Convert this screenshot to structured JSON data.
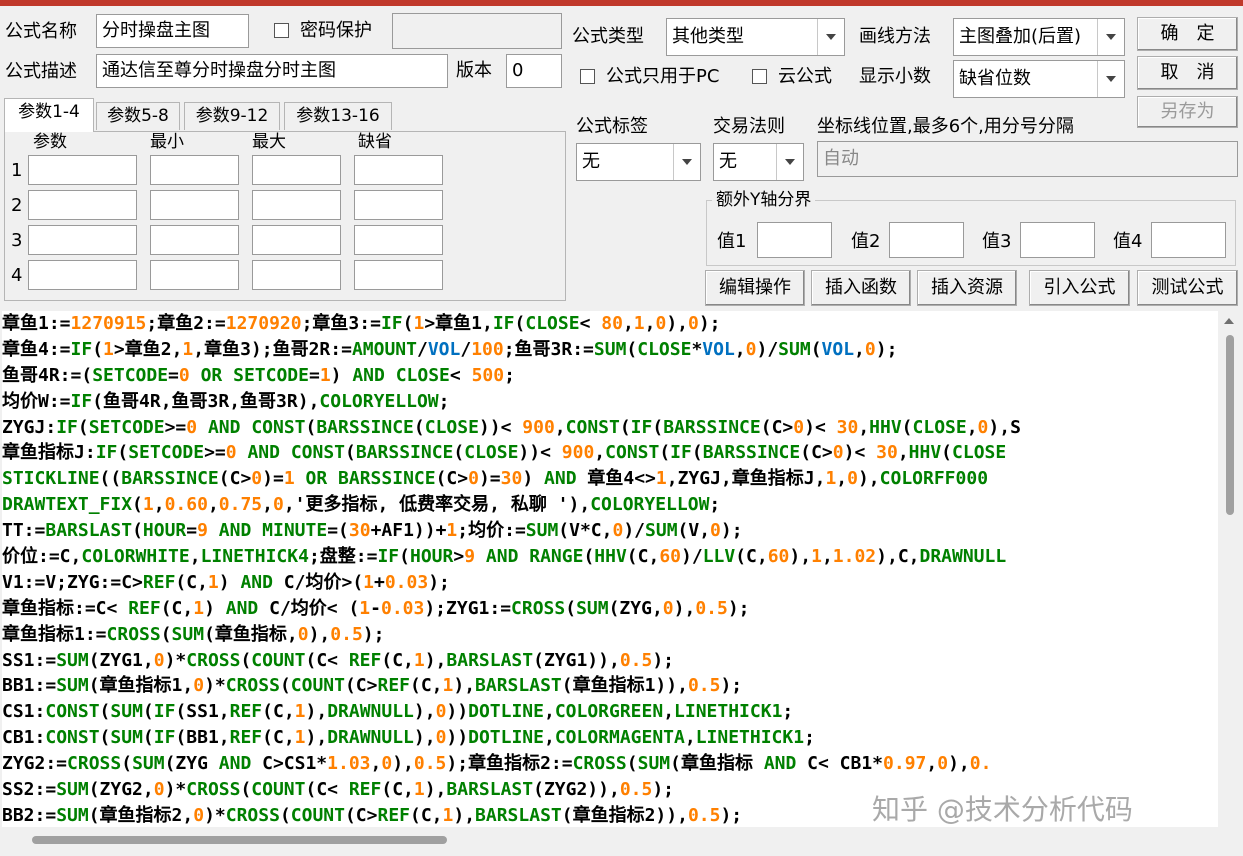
{
  "form": {
    "name_label": "公式名称",
    "name_value": "分时操盘主图",
    "password_label": "密码保护",
    "password_checked": false,
    "desc_label": "公式描述",
    "desc_value": "通达信至尊分时操盘分时主图",
    "version_label": "版本",
    "version_value": "0",
    "type_label": "公式类型",
    "type_value": "其他类型",
    "draw_label": "画线方法",
    "draw_value": "主图叠加(后置)",
    "pc_only_label": "公式只用于PC",
    "pc_only_checked": false,
    "cloud_label": "云公式",
    "cloud_checked": false,
    "decimals_label": "显示小数",
    "decimals_value": "缺省位数",
    "tag_label": "公式标签",
    "tag_value": "无",
    "trade_label": "交易法则",
    "trade_value": "无",
    "axis_label": "坐标线位置,最多6个,用分号分隔",
    "axis_placeholder": "自动",
    "extra_y_title": "额外Y轴分界",
    "extra_y": [
      "值1",
      "值2",
      "值3",
      "值4"
    ]
  },
  "buttons": {
    "ok": "确　定",
    "cancel": "取　消",
    "save_as": "另存为",
    "edit_ops": "编辑操作",
    "insert_func": "插入函数",
    "insert_res": "插入资源",
    "import_formula": "引入公式",
    "test_formula": "测试公式"
  },
  "param_tabs": [
    "参数1-4",
    "参数5-8",
    "参数9-12",
    "参数13-16"
  ],
  "param_headers": [
    "参数",
    "最小",
    "最大",
    "缺省"
  ],
  "param_rows": [
    "1",
    "2",
    "3",
    "4"
  ],
  "colors": {
    "keyword": "#008000",
    "number": "#ff8000",
    "system": "#0070c0",
    "text": "#000000"
  },
  "code_lines": [
    [
      [
        "章鱼1:=",
        "t"
      ],
      [
        "1270915",
        "n"
      ],
      [
        ";章鱼2:=",
        "t"
      ],
      [
        "1270920",
        "n"
      ],
      [
        ";章鱼3:=",
        "t"
      ],
      [
        "IF",
        "k"
      ],
      [
        "(",
        "t"
      ],
      [
        "1",
        "n"
      ],
      [
        ">章鱼1,",
        "t"
      ],
      [
        "IF",
        "k"
      ],
      [
        "(",
        "t"
      ],
      [
        "CLOSE",
        "k"
      ],
      [
        "< ",
        "t"
      ],
      [
        "80",
        "n"
      ],
      [
        ",",
        "t"
      ],
      [
        "1",
        "n"
      ],
      [
        ",",
        "t"
      ],
      [
        "0",
        "n"
      ],
      [
        "),",
        "t"
      ],
      [
        "0",
        "n"
      ],
      [
        ");",
        "t"
      ]
    ],
    [
      [
        "章鱼4:=",
        "t"
      ],
      [
        "IF",
        "k"
      ],
      [
        "(",
        "t"
      ],
      [
        "1",
        "n"
      ],
      [
        ">章鱼2,",
        "t"
      ],
      [
        "1",
        "n"
      ],
      [
        ",章鱼3);鱼哥2R:=",
        "t"
      ],
      [
        "AMOUNT",
        "k"
      ],
      [
        "/",
        "t"
      ],
      [
        "VOL",
        "s"
      ],
      [
        "/",
        "t"
      ],
      [
        "100",
        "n"
      ],
      [
        ";鱼哥3R:=",
        "t"
      ],
      [
        "SUM",
        "k"
      ],
      [
        "(",
        "t"
      ],
      [
        "CLOSE",
        "k"
      ],
      [
        "*",
        "t"
      ],
      [
        "VOL",
        "s"
      ],
      [
        ",",
        "t"
      ],
      [
        "0",
        "n"
      ],
      [
        ")/",
        "t"
      ],
      [
        "SUM",
        "k"
      ],
      [
        "(",
        "t"
      ],
      [
        "VOL",
        "s"
      ],
      [
        ",",
        "t"
      ],
      [
        "0",
        "n"
      ],
      [
        ");",
        "t"
      ]
    ],
    [
      [
        "鱼哥4R:=(",
        "t"
      ],
      [
        "SETCODE",
        "k"
      ],
      [
        "=",
        "t"
      ],
      [
        "0",
        "n"
      ],
      [
        " ",
        "t"
      ],
      [
        "OR",
        "k"
      ],
      [
        " ",
        "t"
      ],
      [
        "SETCODE",
        "k"
      ],
      [
        "=",
        "t"
      ],
      [
        "1",
        "n"
      ],
      [
        ") ",
        "t"
      ],
      [
        "AND",
        "k"
      ],
      [
        " ",
        "t"
      ],
      [
        "CLOSE",
        "k"
      ],
      [
        "< ",
        "t"
      ],
      [
        "500",
        "n"
      ],
      [
        ";",
        "t"
      ]
    ],
    [
      [
        "均价W:=",
        "t"
      ],
      [
        "IF",
        "k"
      ],
      [
        "(鱼哥4R,鱼哥3R,鱼哥3R),",
        "t"
      ],
      [
        "COLORYELLOW",
        "k"
      ],
      [
        ";",
        "t"
      ]
    ],
    [
      [
        "ZYGJ:",
        "t"
      ],
      [
        "IF",
        "k"
      ],
      [
        "(",
        "t"
      ],
      [
        "SETCODE",
        "k"
      ],
      [
        ">=",
        "t"
      ],
      [
        "0",
        "n"
      ],
      [
        " ",
        "t"
      ],
      [
        "AND",
        "k"
      ],
      [
        " ",
        "t"
      ],
      [
        "CONST",
        "k"
      ],
      [
        "(",
        "t"
      ],
      [
        "BARSSINCE",
        "k"
      ],
      [
        "(",
        "t"
      ],
      [
        "CLOSE",
        "k"
      ],
      [
        "))< ",
        "t"
      ],
      [
        "900",
        "n"
      ],
      [
        ",",
        "t"
      ],
      [
        "CONST",
        "k"
      ],
      [
        "(",
        "t"
      ],
      [
        "IF",
        "k"
      ],
      [
        "(",
        "t"
      ],
      [
        "BARSSINCE",
        "k"
      ],
      [
        "(C>",
        "t"
      ],
      [
        "0",
        "n"
      ],
      [
        ")< ",
        "t"
      ],
      [
        "30",
        "n"
      ],
      [
        ",",
        "t"
      ],
      [
        "HHV",
        "k"
      ],
      [
        "(",
        "t"
      ],
      [
        "CLOSE",
        "k"
      ],
      [
        ",",
        "t"
      ],
      [
        "0",
        "n"
      ],
      [
        "),S",
        "t"
      ]
    ],
    [
      [
        "章鱼指标J:",
        "t"
      ],
      [
        "IF",
        "k"
      ],
      [
        "(",
        "t"
      ],
      [
        "SETCODE",
        "k"
      ],
      [
        ">=",
        "t"
      ],
      [
        "0",
        "n"
      ],
      [
        " ",
        "t"
      ],
      [
        "AND",
        "k"
      ],
      [
        " ",
        "t"
      ],
      [
        "CONST",
        "k"
      ],
      [
        "(",
        "t"
      ],
      [
        "BARSSINCE",
        "k"
      ],
      [
        "(",
        "t"
      ],
      [
        "CLOSE",
        "k"
      ],
      [
        "))< ",
        "t"
      ],
      [
        "900",
        "n"
      ],
      [
        ",",
        "t"
      ],
      [
        "CONST",
        "k"
      ],
      [
        "(",
        "t"
      ],
      [
        "IF",
        "k"
      ],
      [
        "(",
        "t"
      ],
      [
        "BARSSINCE",
        "k"
      ],
      [
        "(C>",
        "t"
      ],
      [
        "0",
        "n"
      ],
      [
        ")< ",
        "t"
      ],
      [
        "30",
        "n"
      ],
      [
        ",",
        "t"
      ],
      [
        "HHV",
        "k"
      ],
      [
        "(",
        "t"
      ],
      [
        "CLOSE",
        "k"
      ]
    ],
    [
      [
        "STICKLINE",
        "k"
      ],
      [
        "((",
        "t"
      ],
      [
        "BARSSINCE",
        "k"
      ],
      [
        "(C>",
        "t"
      ],
      [
        "0",
        "n"
      ],
      [
        ")=",
        "t"
      ],
      [
        "1",
        "n"
      ],
      [
        " ",
        "t"
      ],
      [
        "OR",
        "k"
      ],
      [
        " ",
        "t"
      ],
      [
        "BARSSINCE",
        "k"
      ],
      [
        "(C>",
        "t"
      ],
      [
        "0",
        "n"
      ],
      [
        ")=",
        "t"
      ],
      [
        "30",
        "n"
      ],
      [
        ") ",
        "t"
      ],
      [
        "AND",
        "k"
      ],
      [
        " 章鱼4<>",
        "t"
      ],
      [
        "1",
        "n"
      ],
      [
        ",ZYGJ,章鱼指标J,",
        "t"
      ],
      [
        "1",
        "n"
      ],
      [
        ",",
        "t"
      ],
      [
        "0",
        "n"
      ],
      [
        "),",
        "t"
      ],
      [
        "COLORFF000",
        "k"
      ]
    ],
    [
      [
        "DRAWTEXT_FIX",
        "k"
      ],
      [
        "(",
        "t"
      ],
      [
        "1",
        "n"
      ],
      [
        ",",
        "t"
      ],
      [
        "0.60",
        "n"
      ],
      [
        ",",
        "t"
      ],
      [
        "0.75",
        "n"
      ],
      [
        ",",
        "t"
      ],
      [
        "0",
        "n"
      ],
      [
        ",'更多指标, 低费率交易, 私聊 '),",
        "t"
      ],
      [
        "COLORYELLOW",
        "k"
      ],
      [
        ";",
        "t"
      ]
    ],
    [
      [
        "TT:=",
        "t"
      ],
      [
        "BARSLAST",
        "k"
      ],
      [
        "(",
        "t"
      ],
      [
        "HOUR",
        "k"
      ],
      [
        "=",
        "t"
      ],
      [
        "9",
        "n"
      ],
      [
        " ",
        "t"
      ],
      [
        "AND",
        "k"
      ],
      [
        " ",
        "t"
      ],
      [
        "MINUTE",
        "k"
      ],
      [
        "=(",
        "t"
      ],
      [
        "30",
        "n"
      ],
      [
        "+AF1))+",
        "t"
      ],
      [
        "1",
        "n"
      ],
      [
        ";均价:=",
        "t"
      ],
      [
        "SUM",
        "k"
      ],
      [
        "(V*C,",
        "t"
      ],
      [
        "0",
        "n"
      ],
      [
        ")/",
        "t"
      ],
      [
        "SUM",
        "k"
      ],
      [
        "(V,",
        "t"
      ],
      [
        "0",
        "n"
      ],
      [
        ");",
        "t"
      ]
    ],
    [
      [
        "价位:=C,",
        "t"
      ],
      [
        "COLORWHITE",
        "k"
      ],
      [
        ",",
        "t"
      ],
      [
        "LINETHICK4",
        "k"
      ],
      [
        ";盘整:=",
        "t"
      ],
      [
        "IF",
        "k"
      ],
      [
        "(",
        "t"
      ],
      [
        "HOUR",
        "k"
      ],
      [
        ">",
        "t"
      ],
      [
        "9",
        "n"
      ],
      [
        " ",
        "t"
      ],
      [
        "AND",
        "k"
      ],
      [
        " ",
        "t"
      ],
      [
        "RANGE",
        "k"
      ],
      [
        "(",
        "t"
      ],
      [
        "HHV",
        "k"
      ],
      [
        "(C,",
        "t"
      ],
      [
        "60",
        "n"
      ],
      [
        ")/",
        "t"
      ],
      [
        "LLV",
        "k"
      ],
      [
        "(C,",
        "t"
      ],
      [
        "60",
        "n"
      ],
      [
        "),",
        "t"
      ],
      [
        "1",
        "n"
      ],
      [
        ",",
        "t"
      ],
      [
        "1.02",
        "n"
      ],
      [
        "),C,",
        "t"
      ],
      [
        "DRAWNULL",
        "k"
      ]
    ],
    [
      [
        "V1:=V;ZYG:=C>",
        "t"
      ],
      [
        "REF",
        "k"
      ],
      [
        "(C,",
        "t"
      ],
      [
        "1",
        "n"
      ],
      [
        ") ",
        "t"
      ],
      [
        "AND",
        "k"
      ],
      [
        " C/均价>(",
        "t"
      ],
      [
        "1",
        "n"
      ],
      [
        "+",
        "t"
      ],
      [
        "0.03",
        "n"
      ],
      [
        ");",
        "t"
      ]
    ],
    [
      [
        "章鱼指标:=C< ",
        "t"
      ],
      [
        "REF",
        "k"
      ],
      [
        "(C,",
        "t"
      ],
      [
        "1",
        "n"
      ],
      [
        ") ",
        "t"
      ],
      [
        "AND",
        "k"
      ],
      [
        " C/均价< (",
        "t"
      ],
      [
        "1",
        "n"
      ],
      [
        "-",
        "t"
      ],
      [
        "0.03",
        "n"
      ],
      [
        ");ZYG1:=",
        "t"
      ],
      [
        "CROSS",
        "k"
      ],
      [
        "(",
        "t"
      ],
      [
        "SUM",
        "k"
      ],
      [
        "(ZYG,",
        "t"
      ],
      [
        "0",
        "n"
      ],
      [
        "),",
        "t"
      ],
      [
        "0.5",
        "n"
      ],
      [
        ");",
        "t"
      ]
    ],
    [
      [
        "章鱼指标1:=",
        "t"
      ],
      [
        "CROSS",
        "k"
      ],
      [
        "(",
        "t"
      ],
      [
        "SUM",
        "k"
      ],
      [
        "(章鱼指标,",
        "t"
      ],
      [
        "0",
        "n"
      ],
      [
        "),",
        "t"
      ],
      [
        "0.5",
        "n"
      ],
      [
        ");",
        "t"
      ]
    ],
    [
      [
        "SS1:=",
        "t"
      ],
      [
        "SUM",
        "k"
      ],
      [
        "(ZYG1,",
        "t"
      ],
      [
        "0",
        "n"
      ],
      [
        ")*",
        "t"
      ],
      [
        "CROSS",
        "k"
      ],
      [
        "(",
        "t"
      ],
      [
        "COUNT",
        "k"
      ],
      [
        "(C< ",
        "t"
      ],
      [
        "REF",
        "k"
      ],
      [
        "(C,",
        "t"
      ],
      [
        "1",
        "n"
      ],
      [
        "),",
        "t"
      ],
      [
        "BARSLAST",
        "k"
      ],
      [
        "(ZYG1)),",
        "t"
      ],
      [
        "0.5",
        "n"
      ],
      [
        ");",
        "t"
      ]
    ],
    [
      [
        "BB1:=",
        "t"
      ],
      [
        "SUM",
        "k"
      ],
      [
        "(章鱼指标1,",
        "t"
      ],
      [
        "0",
        "n"
      ],
      [
        ")*",
        "t"
      ],
      [
        "CROSS",
        "k"
      ],
      [
        "(",
        "t"
      ],
      [
        "COUNT",
        "k"
      ],
      [
        "(C>",
        "t"
      ],
      [
        "REF",
        "k"
      ],
      [
        "(C,",
        "t"
      ],
      [
        "1",
        "n"
      ],
      [
        "),",
        "t"
      ],
      [
        "BARSLAST",
        "k"
      ],
      [
        "(章鱼指标1)),",
        "t"
      ],
      [
        "0.5",
        "n"
      ],
      [
        ");",
        "t"
      ]
    ],
    [
      [
        "CS1:",
        "t"
      ],
      [
        "CONST",
        "k"
      ],
      [
        "(",
        "t"
      ],
      [
        "SUM",
        "k"
      ],
      [
        "(",
        "t"
      ],
      [
        "IF",
        "k"
      ],
      [
        "(SS1,",
        "t"
      ],
      [
        "REF",
        "k"
      ],
      [
        "(C,",
        "t"
      ],
      [
        "1",
        "n"
      ],
      [
        "),",
        "t"
      ],
      [
        "DRAWNULL",
        "k"
      ],
      [
        "),",
        "t"
      ],
      [
        "0",
        "n"
      ],
      [
        "))",
        "t"
      ],
      [
        "DOTLINE",
        "k"
      ],
      [
        ",",
        "t"
      ],
      [
        "COLORGREEN",
        "k"
      ],
      [
        ",",
        "t"
      ],
      [
        "LINETHICK1",
        "k"
      ],
      [
        ";",
        "t"
      ]
    ],
    [
      [
        "CB1:",
        "t"
      ],
      [
        "CONST",
        "k"
      ],
      [
        "(",
        "t"
      ],
      [
        "SUM",
        "k"
      ],
      [
        "(",
        "t"
      ],
      [
        "IF",
        "k"
      ],
      [
        "(BB1,",
        "t"
      ],
      [
        "REF",
        "k"
      ],
      [
        "(C,",
        "t"
      ],
      [
        "1",
        "n"
      ],
      [
        "),",
        "t"
      ],
      [
        "DRAWNULL",
        "k"
      ],
      [
        "),",
        "t"
      ],
      [
        "0",
        "n"
      ],
      [
        "))",
        "t"
      ],
      [
        "DOTLINE",
        "k"
      ],
      [
        ",",
        "t"
      ],
      [
        "COLORMAGENTA",
        "k"
      ],
      [
        ",",
        "t"
      ],
      [
        "LINETHICK1",
        "k"
      ],
      [
        ";",
        "t"
      ]
    ],
    [
      [
        "ZYG2:=",
        "t"
      ],
      [
        "CROSS",
        "k"
      ],
      [
        "(",
        "t"
      ],
      [
        "SUM",
        "k"
      ],
      [
        "(ZYG ",
        "t"
      ],
      [
        "AND",
        "k"
      ],
      [
        " C>CS1*",
        "t"
      ],
      [
        "1.03",
        "n"
      ],
      [
        ",",
        "t"
      ],
      [
        "0",
        "n"
      ],
      [
        "),",
        "t"
      ],
      [
        "0.5",
        "n"
      ],
      [
        ");章鱼指标2:=",
        "t"
      ],
      [
        "CROSS",
        "k"
      ],
      [
        "(",
        "t"
      ],
      [
        "SUM",
        "k"
      ],
      [
        "(章鱼指标 ",
        "t"
      ],
      [
        "AND",
        "k"
      ],
      [
        " C< CB1*",
        "t"
      ],
      [
        "0.97",
        "n"
      ],
      [
        ",",
        "t"
      ],
      [
        "0",
        "n"
      ],
      [
        "),",
        "t"
      ],
      [
        "0.",
        "n"
      ]
    ],
    [
      [
        "SS2:=",
        "t"
      ],
      [
        "SUM",
        "k"
      ],
      [
        "(ZYG2,",
        "t"
      ],
      [
        "0",
        "n"
      ],
      [
        ")*",
        "t"
      ],
      [
        "CROSS",
        "k"
      ],
      [
        "(",
        "t"
      ],
      [
        "COUNT",
        "k"
      ],
      [
        "(C< ",
        "t"
      ],
      [
        "REF",
        "k"
      ],
      [
        "(C,",
        "t"
      ],
      [
        "1",
        "n"
      ],
      [
        "),",
        "t"
      ],
      [
        "BARSLAST",
        "k"
      ],
      [
        "(ZYG2)),",
        "t"
      ],
      [
        "0.5",
        "n"
      ],
      [
        ");",
        "t"
      ]
    ],
    [
      [
        "BB2:=",
        "t"
      ],
      [
        "SUM",
        "k"
      ],
      [
        "(章鱼指标2,",
        "t"
      ],
      [
        "0",
        "n"
      ],
      [
        ")*",
        "t"
      ],
      [
        "CROSS",
        "k"
      ],
      [
        "(",
        "t"
      ],
      [
        "COUNT",
        "k"
      ],
      [
        "(C>",
        "t"
      ],
      [
        "REF",
        "k"
      ],
      [
        "(C,",
        "t"
      ],
      [
        "1",
        "n"
      ],
      [
        "),",
        "t"
      ],
      [
        "BARSLAST",
        "k"
      ],
      [
        "(章鱼指标2)),",
        "t"
      ],
      [
        "0.5",
        "n"
      ],
      [
        ");",
        "t"
      ]
    ]
  ],
  "watermark": "知乎 @技术分析代码"
}
